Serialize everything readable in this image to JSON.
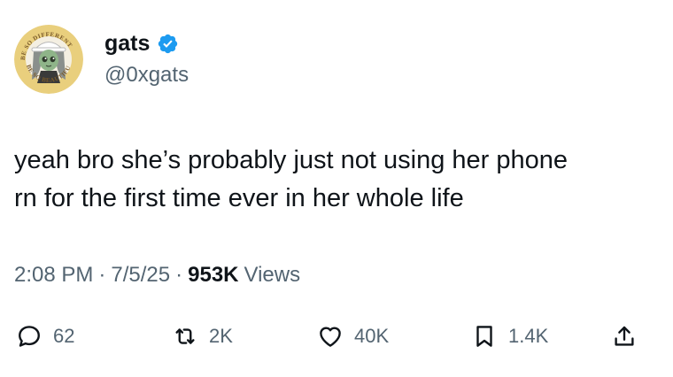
{
  "author": {
    "display_name": "gats",
    "handle": "@0xgats",
    "verified": true,
    "avatar_top_text": "BE SO DIFFERENT",
    "avatar_bottom_text": "BE SO BEAUTIFUL"
  },
  "tweet": {
    "text": "yeah bro she’s probably just not using her phone\nrn for the first time ever in her whole life"
  },
  "meta": {
    "time": "2:08 PM",
    "separator": "·",
    "date": "7/5/25",
    "views_count": "953K",
    "views_label": "Views"
  },
  "actions": {
    "replies": "62",
    "reposts": "2K",
    "likes": "40K",
    "bookmarks": "1.4K"
  },
  "colors": {
    "verified_blue": "#1d9bf0",
    "secondary_text": "#536471",
    "primary_text": "#0f1419"
  }
}
